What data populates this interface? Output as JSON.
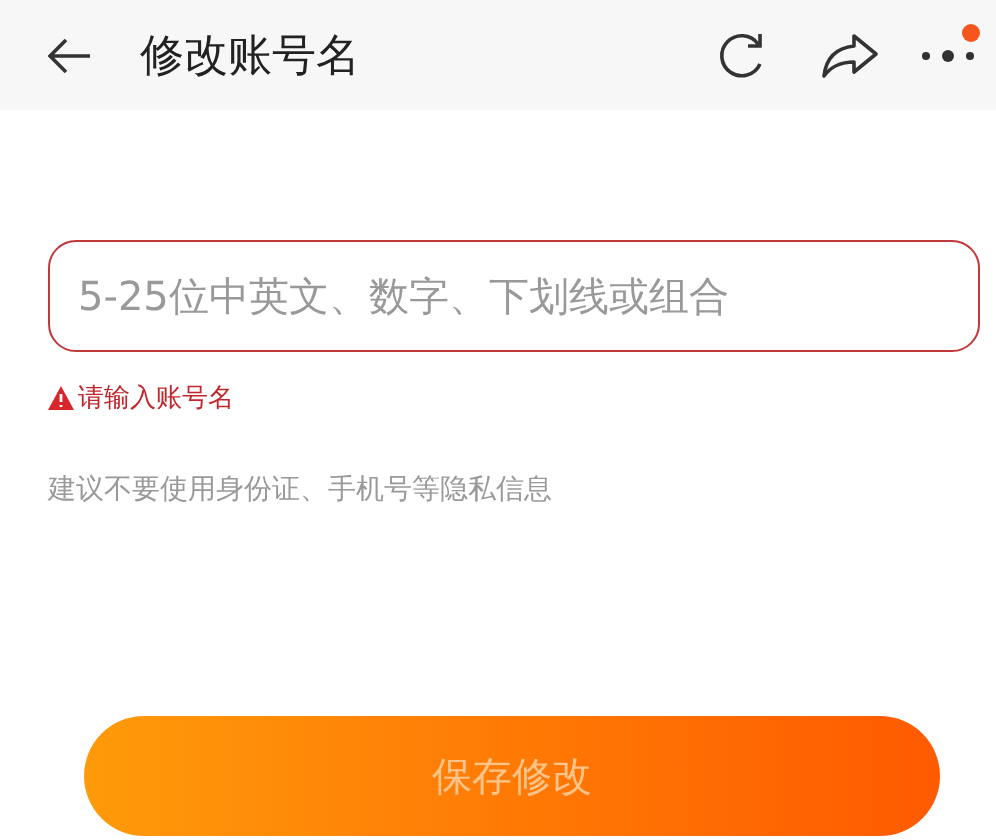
{
  "header": {
    "title": "修改账号名",
    "menu_badge": true
  },
  "field": {
    "placeholder": "5-25位中英文、数字、下划线或组合",
    "error": true
  },
  "error_message": "请输入账号名",
  "hint": "建议不要使用身份证、手机号等隐私信息",
  "save_button": {
    "label": "保存修改",
    "disabled": true
  }
}
